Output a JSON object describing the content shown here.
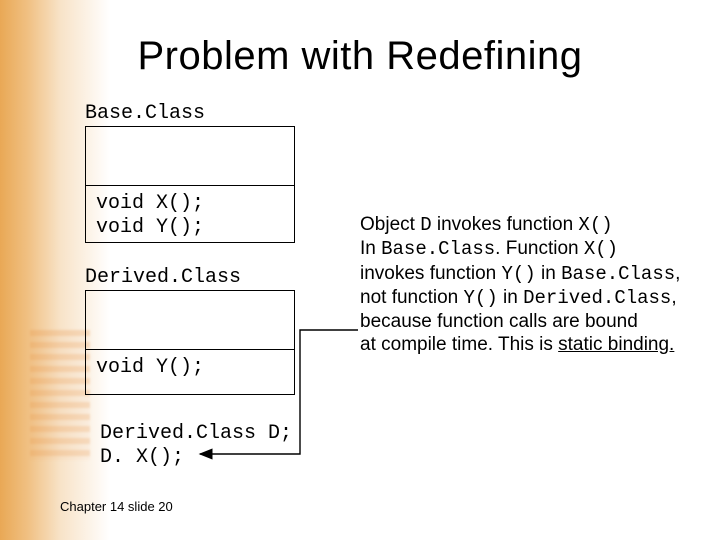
{
  "title": "Problem with Redefining",
  "base_label": "Base.Class",
  "base_methods": "void X();\nvoid Y();",
  "derived_label": "Derived.Class",
  "derived_methods": "void Y();",
  "snippet": "Derived.Class D;\nD. X();",
  "explain": {
    "t1": "Object ",
    "c1": "D",
    "t2": " invokes function ",
    "c2": "X()",
    "t3": "\nIn ",
    "c3": "Base.Class",
    "t4": ".  Function ",
    "c4": "X()",
    "t5": "\ninvokes function ",
    "c5": "Y()",
    "t6": " in ",
    "c6": "Base.Class",
    "t7": ",\nnot function ",
    "c7": "Y()",
    "t8": " in ",
    "c8": "Derived.Class",
    "t9": ",\nbecause function calls are bound\nat compile time.  This is ",
    "u": "static binding.",
    "t10": ""
  },
  "footer": "Chapter 14 slide 20"
}
